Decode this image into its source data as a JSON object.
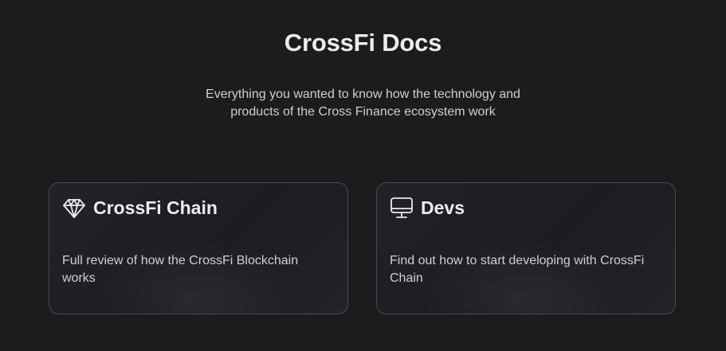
{
  "hero": {
    "title": "CrossFi Docs",
    "subtitle": "Everything you wanted to know how the technology and products of the Cross Finance ecosystem work"
  },
  "cards": [
    {
      "icon": "diamond-icon",
      "title": "CrossFi Chain",
      "description": "Full review of how the CrossFi Blockchain works"
    },
    {
      "icon": "monitor-icon",
      "title": "Devs",
      "description": "Find out how to start developing with CrossFi Chain"
    }
  ],
  "colors": {
    "background": "#1c1c1f",
    "text": "#ececec",
    "muted_text": "#cfcfd2",
    "card_border": "#4a4a4f"
  }
}
